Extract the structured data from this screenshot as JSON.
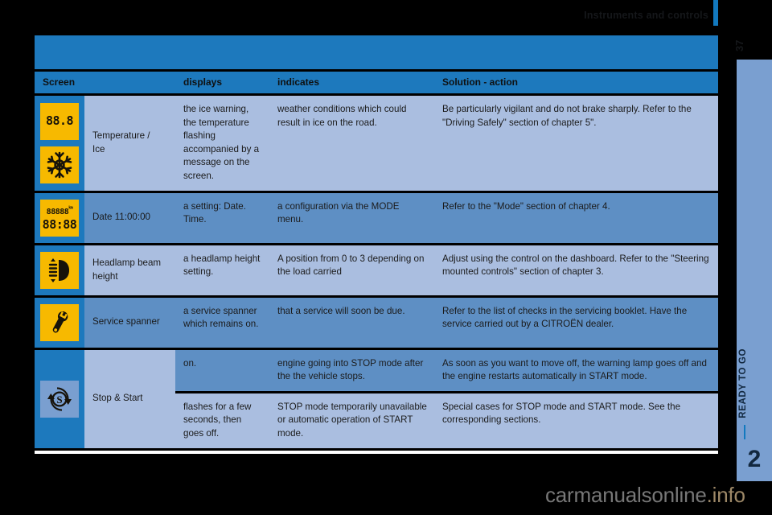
{
  "header": {
    "title": "Instruments and controls",
    "page_number": "37"
  },
  "side_tab": {
    "chapter_label": "READY TO GO",
    "chapter_number": "2"
  },
  "table": {
    "columns": [
      "Screen",
      "displays",
      "indicates",
      "Solution - action"
    ],
    "rows": [
      {
        "screen_label": "Temperature /\nIce",
        "icons": [
          "temperature-display-icon",
          "snowflake-icon"
        ],
        "icon_texts": [
          "88.8",
          ""
        ],
        "displays": "the ice warning, the temperature flashing accompanied by a message on the screen.",
        "indicates": "weather conditions which could result in ice on the road.",
        "solution": "Be particularly vigilant and do not brake sharply. Refer to the \"Driving Safely\" section of chapter 5\"."
      },
      {
        "screen_label": "Date 11:00:00",
        "icons": [
          "odometer-clock-display-icon"
        ],
        "icon_texts": [
          "88888",
          "km",
          "88:88"
        ],
        "displays": "a setting: Date. Time.",
        "indicates": "a configuration via the MODE menu.",
        "solution": "Refer to the \"Mode\" section of chapter 4."
      },
      {
        "screen_label": "Headlamp beam height",
        "icons": [
          "headlamp-beam-height-icon"
        ],
        "icon_texts": [],
        "displays": "a headlamp height setting.",
        "indicates": "A position from 0 to 3 depending on the load carried",
        "solution": "Adjust using the control on the dashboard. Refer to the \"Steering mounted controls\" section of chapter 3."
      },
      {
        "screen_label": "Service spanner",
        "icons": [
          "service-spanner-icon"
        ],
        "icon_texts": [],
        "displays": "a service spanner which remains on.",
        "indicates": "that a service will soon be due.",
        "solution": "Refer to the list of checks in the servicing booklet. Have the service carried out by a CITROËN dealer."
      }
    ],
    "stop_start": {
      "screen_label": "Stop & Start",
      "icon": "stop-start-icon",
      "sub_rows": [
        {
          "displays": "on.",
          "indicates": "engine going into STOP mode after the the vehicle stops.",
          "solution": "As soon as you want to move off, the warning lamp goes off and the engine restarts automatically in START mode."
        },
        {
          "displays": "flashes for a few seconds, then goes off.",
          "indicates": "STOP mode temporarily unavailable or automatic operation of START mode.",
          "solution": "Special cases for STOP mode and START mode. See the corresponding sections."
        }
      ]
    }
  },
  "watermark": {
    "name": "carmanualsonline",
    "tld": ".info"
  },
  "colors": {
    "header_blue": "#1d79bd",
    "row_light": "#aabee0",
    "row_dark": "#5e8fc4",
    "icon_yellow": "#f7b900",
    "tab_blue": "#7a9fd0",
    "accent_blue": "#1279bf"
  }
}
